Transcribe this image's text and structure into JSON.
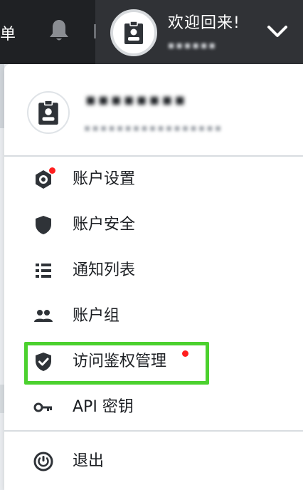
{
  "header": {
    "left_text": "单",
    "welcome": "欢迎回来!",
    "username_masked": "▪▪▪▪▪▪"
  },
  "user": {
    "name_masked": "▪▪▪▪▪▪▪▪",
    "email_masked": "▪▪▪▪▪▪▪▪▪▪▪▪▪▪▪▪▪"
  },
  "menu": {
    "items": [
      {
        "label": "账户设置",
        "icon": "hexagon-gear-icon",
        "dot": true
      },
      {
        "label": "账户安全",
        "icon": "shield-icon",
        "dot": false
      },
      {
        "label": "通知列表",
        "icon": "list-icon",
        "dot": false
      },
      {
        "label": "账户组",
        "icon": "users-icon",
        "dot": false
      },
      {
        "label": "访问鉴权管理",
        "icon": "shield-check-icon",
        "dot": true,
        "highlighted": true
      },
      {
        "label": "API 密钥",
        "icon": "key-icon",
        "dot": false
      }
    ],
    "logout": {
      "label": "退出",
      "icon": "power-icon"
    }
  },
  "colors": {
    "topbar": "#1f2124",
    "accent_dot": "#ff1f1f",
    "highlight": "#4bd12e"
  }
}
